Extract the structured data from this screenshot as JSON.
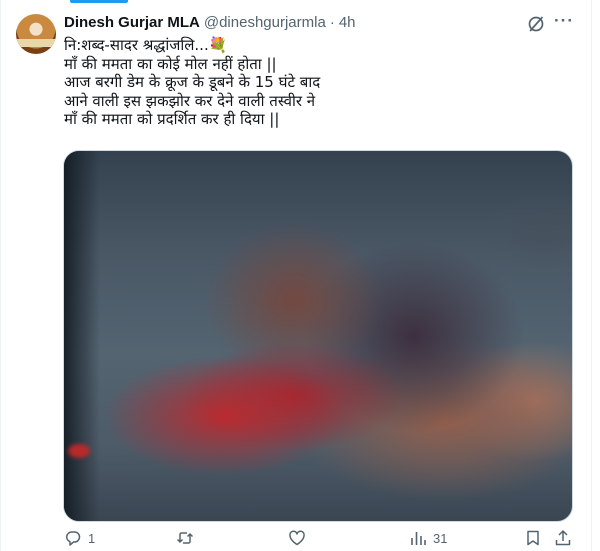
{
  "tweet": {
    "author_name": "Dinesh Gurjar MLA",
    "handle": "@dineshgurjarmla",
    "separator": "·",
    "time": "4h",
    "avatar_text": "सत्य",
    "lines": [
      "नि:शब्द-सादर श्रद्धांजलि...💐",
      "माँ की ममता का कोई मोल नहीं होता ||",
      "आज बरगी डेम के क्रूज के डूबने के 15 घंटे बाद",
      "आने वाली इस झकझोर कर देने वाली तस्वीर ने",
      "माँ की ममता को प्रदर्शित कर ही दिया ||"
    ],
    "media_description": "blurred photo"
  },
  "actions": {
    "reply_count": "1",
    "retweet_count": "",
    "like_count": "",
    "views_count": "31"
  },
  "icons": {
    "grok": "grok-icon",
    "more": "more-icon",
    "reply": "reply-icon",
    "retweet": "retweet-icon",
    "like": "heart-icon",
    "views": "views-icon",
    "bookmark": "bookmark-icon",
    "share": "share-icon"
  },
  "colors": {
    "accent": "#1d9bf0",
    "text": "#0f1419",
    "muted": "#536471",
    "border": "#cfd9de"
  }
}
